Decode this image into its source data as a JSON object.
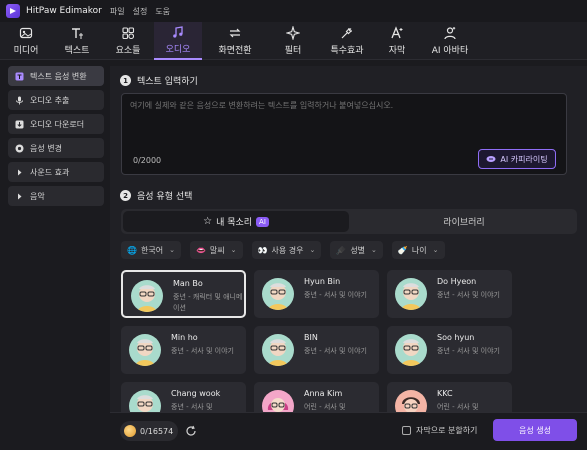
{
  "app": {
    "title": "HitPaw Edimakor"
  },
  "menu": [
    "파일",
    "설정",
    "도움"
  ],
  "toolbar": [
    {
      "label": "미디어",
      "icon": "media-icon"
    },
    {
      "label": "텍스트",
      "icon": "text-icon"
    },
    {
      "label": "요소들",
      "icon": "elements-icon"
    },
    {
      "label": "오디오",
      "icon": "music-note-icon",
      "active": true
    },
    {
      "label": "화면전환",
      "icon": "transition-icon"
    },
    {
      "label": "필터",
      "icon": "filter-icon"
    },
    {
      "label": "특수효과",
      "icon": "effects-icon"
    },
    {
      "label": "자막",
      "icon": "subtitle-icon"
    },
    {
      "label": "AI 아바타",
      "icon": "avatar-icon"
    }
  ],
  "sidebar": [
    {
      "label": "텍스트 음성 변환",
      "icon": "tts-icon",
      "active": true
    },
    {
      "label": "오디오 추출",
      "icon": "mic-icon"
    },
    {
      "label": "오디오 다운로더",
      "icon": "download-icon"
    },
    {
      "label": "음성 변경",
      "icon": "voice-change-icon"
    },
    {
      "label": "사운드 효과",
      "icon": "chevron-right-icon"
    },
    {
      "label": "음악",
      "icon": "chevron-right-icon"
    }
  ],
  "step1": {
    "num": "1",
    "title": "텍스트 입력하기"
  },
  "text_input": {
    "placeholder": "여기에 실제와 같은 음성으로 변환하려는 텍스트를 입력하거나 붙여넣으십시오.",
    "counter": "0/2000",
    "ai_button": "AI 카피라이팅"
  },
  "step2": {
    "num": "2",
    "title": "음성 유형 선택"
  },
  "tabs": {
    "mine": "내 목소리",
    "ai_badge": "AI",
    "library": "라이브러리"
  },
  "filters": [
    {
      "label": "한국어",
      "icon": "globe-icon"
    },
    {
      "label": "말씨",
      "icon": "lips-icon"
    },
    {
      "label": "사용 경우",
      "icon": "eyes-icon"
    },
    {
      "label": "성별",
      "icon": "gender-icon"
    },
    {
      "label": "나이",
      "icon": "age-icon"
    }
  ],
  "voices": [
    {
      "name": "Man Bo",
      "desc": "중년 - 캐릭터 및 애니메이션",
      "selected": true,
      "avatar": "#a9dbcc"
    },
    {
      "name": "Hyun Bin",
      "desc": "중년 - 서사 및 이야기",
      "avatar": "#a9dbcc"
    },
    {
      "name": "Do Hyeon",
      "desc": "중년 - 서사 및 이야기",
      "avatar": "#a9dbcc"
    },
    {
      "name": "Min ho",
      "desc": "중년 - 서사 및 이야기",
      "avatar": "#a9dbcc"
    },
    {
      "name": "BIN",
      "desc": "중년 - 서사 및 이야기",
      "avatar": "#a9dbcc"
    },
    {
      "name": "Soo hyun",
      "desc": "중년 - 서사 및 이야기",
      "avatar": "#a9dbcc"
    },
    {
      "name": "Chang wook",
      "desc": "중년 - 서사 및",
      "avatar": "#a9dbcc"
    },
    {
      "name": "Anna Kim",
      "desc": "어린 - 서사 및",
      "avatar": "#f3a6c8"
    },
    {
      "name": "KKC",
      "desc": "어린 - 서사 및",
      "avatar": "#f4b4a5"
    }
  ],
  "bottom": {
    "credits": "0/16574",
    "split_label": "자막으로 분할하기",
    "generate": "음성 생성"
  },
  "colors": {
    "accent": "#8b5cf6",
    "background": "#1b1b1f"
  }
}
